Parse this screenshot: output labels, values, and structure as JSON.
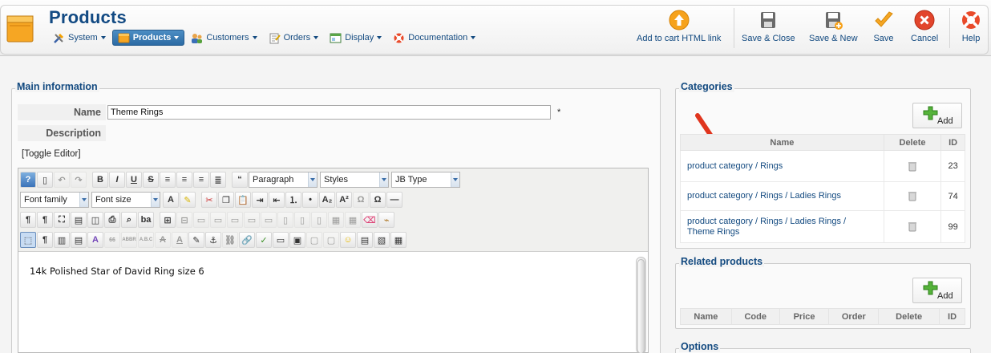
{
  "header": {
    "title": "Products",
    "menu": [
      {
        "label": "System",
        "icon": "wrench-screwdriver-icon"
      },
      {
        "label": "Products",
        "icon": "box-icon",
        "active": true
      },
      {
        "label": "Customers",
        "icon": "users-icon"
      },
      {
        "label": "Orders",
        "icon": "orders-icon"
      },
      {
        "label": "Display",
        "icon": "display-icon"
      },
      {
        "label": "Documentation",
        "icon": "lifebuoy-icon"
      }
    ],
    "toolbar": {
      "add_to_cart": "Add to cart HTML link",
      "save_close": "Save & Close",
      "save_new": "Save & New",
      "save": "Save",
      "cancel": "Cancel",
      "help": "Help"
    }
  },
  "main_info": {
    "legend": "Main information",
    "name_label": "Name",
    "name_value": "Theme Rings",
    "required_mark": "*",
    "description_label": "Description",
    "toggle_editor": "[Toggle Editor]",
    "editor": {
      "format_select": "Paragraph",
      "styles_select": "Styles",
      "type_select": "JB Type",
      "font_family_select": "Font family",
      "font_size_select": "Font size",
      "content": "14k Polished Star of David Ring size 6"
    }
  },
  "categories": {
    "legend": "Categories",
    "add_label": "Add",
    "columns": [
      "Name",
      "Delete",
      "ID"
    ],
    "rows": [
      {
        "name": "product category / Rings",
        "id": "23"
      },
      {
        "name": "product category / Rings / Ladies Rings",
        "id": "74"
      },
      {
        "name": "product category / Rings / Ladies Rings / Theme Rings",
        "id": "99"
      }
    ]
  },
  "related_products": {
    "legend": "Related products",
    "add_label": "Add",
    "columns": [
      "Name",
      "Code",
      "Price",
      "Order",
      "Delete",
      "ID"
    ]
  },
  "options": {
    "legend": "Options"
  },
  "colors": {
    "link": "#134a80",
    "active_menu": "#2b6aa3",
    "save_check": "#f5a623",
    "cancel_red": "#e2452c",
    "arrow_red": "#e0351e"
  }
}
